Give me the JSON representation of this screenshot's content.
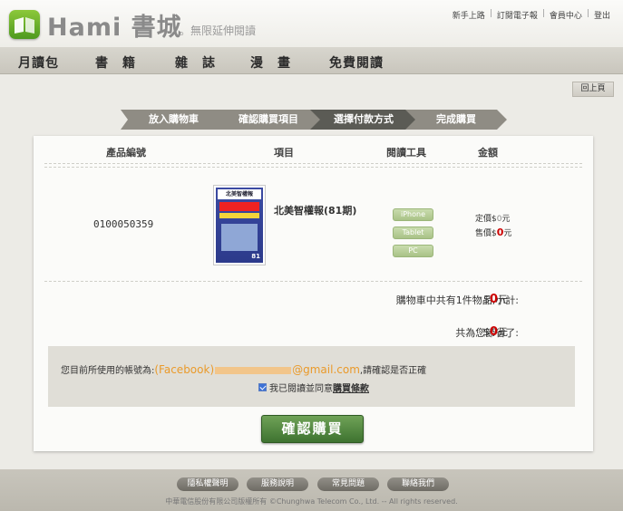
{
  "header": {
    "logo_text": "Hami 書城",
    "tagline": "。無限延伸閱讀",
    "top_links": [
      "新手上路",
      "訂閱電子報",
      "會員中心",
      "登出"
    ]
  },
  "nav": {
    "items": [
      "月讀包",
      "書　籍",
      "雜　誌",
      "漫　畫",
      "免費閱讀"
    ]
  },
  "back_label": "回上頁",
  "steps": [
    "放入購物車",
    "確認購買項目",
    "選擇付款方式",
    "完成購買"
  ],
  "table": {
    "headers": [
      "產品編號",
      "項目",
      "閱讀工具",
      "金額"
    ],
    "row": {
      "product_id": "0100050359",
      "title": "北美智權報(81期)",
      "cover_title": "北美智權報",
      "cover_issue": "81",
      "tools": [
        "iPhone",
        "Tablet",
        "PC"
      ],
      "list_price_label": "定價$",
      "list_price": "0",
      "sale_price_label": "售價$",
      "sale_price": "0",
      "currency": "元"
    }
  },
  "summary": {
    "subtotal_label": "購物車中共有1件物品,小計:",
    "subtotal_value": "0",
    "saved_label": "共為您節省了:",
    "saved_value": "0",
    "dollar": "$",
    "currency": "元"
  },
  "confirm": {
    "account_prefix": "您目前所使用的帳號為:",
    "account_provider": "(Facebook)",
    "account_domain": "@gmail.com",
    "account_suffix": ",請確認是否正確",
    "agree_text": "我已閱讀並同意",
    "terms_link": "購買條款"
  },
  "buy_button": "確認購買",
  "footer": {
    "links": [
      "隱私權聲明",
      "服務說明",
      "常見問題",
      "聯絡我們"
    ],
    "copyright": "中華電信股份有限公司版權所有 ©Chunghwa Telecom Co., Ltd. -- All rights reserved."
  },
  "colors": {
    "accent_green": "#4e9a1f",
    "price_red": "#cc0000",
    "step_active": "#5b5b55",
    "button_green": "#3e7330"
  }
}
